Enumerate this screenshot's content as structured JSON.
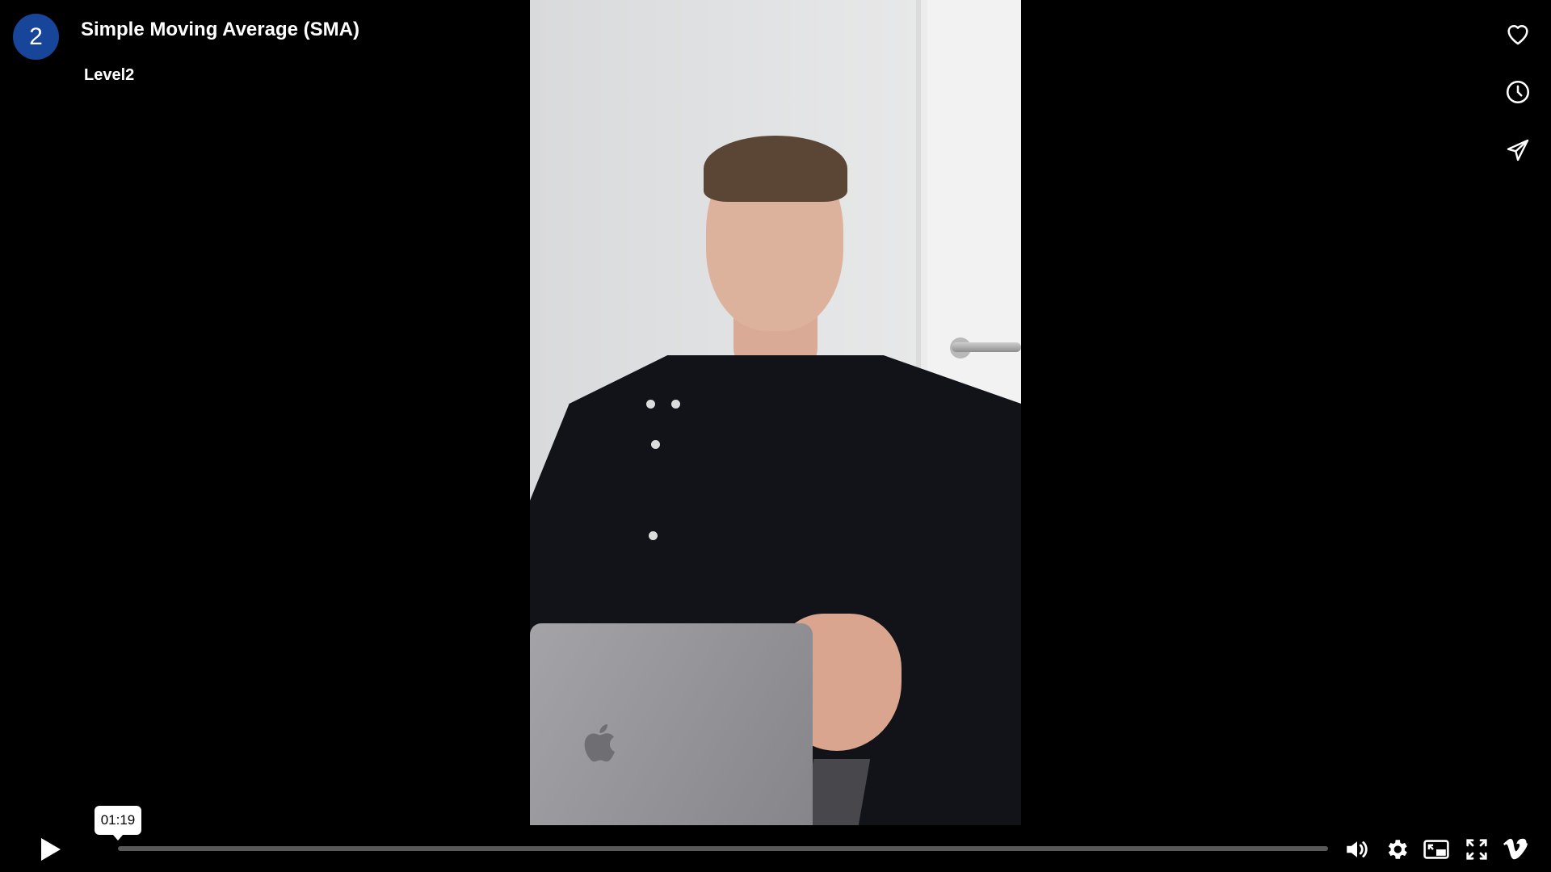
{
  "header": {
    "avatar_text": "2",
    "title": "Simple Moving Average (SMA)",
    "byline": "Level2"
  },
  "side_actions": [
    {
      "name": "like",
      "icon": "heart-icon"
    },
    {
      "name": "watch-later",
      "icon": "clock-icon"
    },
    {
      "name": "share",
      "icon": "paper-plane-icon"
    }
  ],
  "controls": {
    "play_icon": "play-icon",
    "time_tooltip": "01:19",
    "progress_fraction": 0.0,
    "right_icons": [
      "volume-icon",
      "gear-icon",
      "picture-in-picture-icon",
      "fullscreen-icon",
      "vimeo-logo-icon"
    ]
  },
  "colors": {
    "background": "#000000",
    "avatar": "#17459a",
    "progress_track": "#595959",
    "tooltip_bg": "#ffffff"
  }
}
